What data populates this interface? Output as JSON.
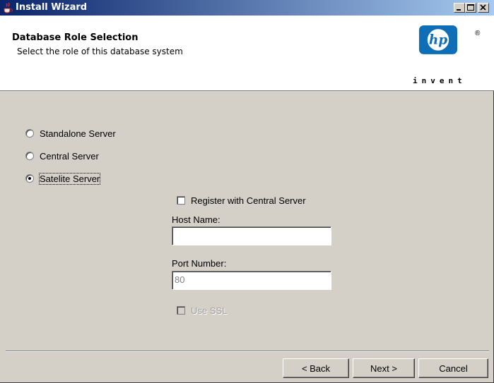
{
  "window": {
    "title": "Install Wizard"
  },
  "header": {
    "title": "Database Role Selection",
    "subtitle": "Select the role of this database system",
    "logo_text": "invent",
    "logo_mark": "hp",
    "logo_reg": "®"
  },
  "roles": [
    {
      "label": "Standalone Server",
      "selected": false
    },
    {
      "label": "Central Server",
      "selected": false
    },
    {
      "label": "Satelite Server",
      "selected": true
    }
  ],
  "registration": {
    "register_label": "Register with Central Server",
    "register_checked": false,
    "host_name_label": "Host Name:",
    "host_name_value": "",
    "port_number_label": "Port Number:",
    "port_number_value": "80",
    "use_ssl_label": "Use SSL",
    "use_ssl_checked": false
  },
  "buttons": {
    "back": "< Back",
    "next": "Next >",
    "cancel": "Cancel"
  },
  "colors": {
    "titlebar_start": "#0a246a",
    "titlebar_end": "#a6caf0",
    "hp_blue": "#0e6eb8",
    "dialog_bg": "#d4d0c8"
  }
}
